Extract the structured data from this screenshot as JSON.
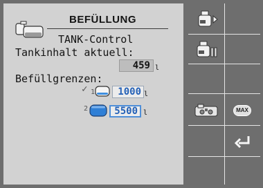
{
  "screen": {
    "title": "BEFÜLLUNG",
    "subtitle": "TANK-Control",
    "tank_label": "Tankinhalt aktuell:",
    "tank_value": "459",
    "tank_unit": "l",
    "limits_label": "Befüllgrenzen:",
    "limits": [
      {
        "index": "1",
        "value": "1000",
        "unit": "l",
        "selected": true
      },
      {
        "index": "2",
        "value": "5500",
        "unit": "l",
        "selected": false
      }
    ]
  },
  "softkeys": {
    "max_label": "MAX"
  },
  "icons": {
    "header": "sprayer-tank-icon",
    "check": "checkmark-icon",
    "tank_small": "tank-outline-icon",
    "tank_full": "tank-full-icon",
    "fill_start": "filling-start-icon",
    "fill_pause": "filling-pause-icon",
    "pump": "pump-machine-icon",
    "max": "max-icon",
    "back": "return-arrow-icon"
  },
  "colors": {
    "panel": "#d2d2d2",
    "background": "#6e6e6e",
    "value_blue": "#2461b7",
    "active_border": "#4f8fd8"
  }
}
